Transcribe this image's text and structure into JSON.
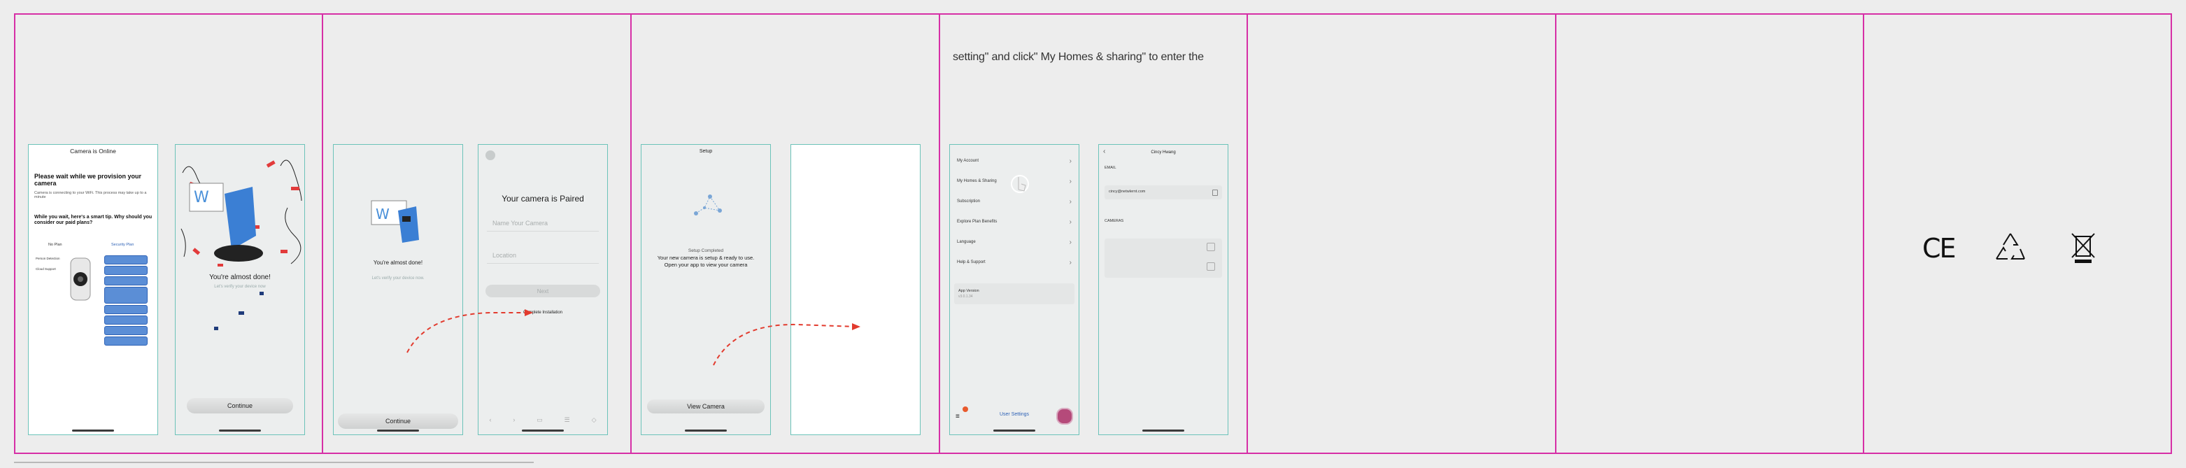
{
  "heading": "setting\" and click\" My Homes & sharing\" to enter the",
  "screen1": {
    "title": "Camera is Online",
    "wait_text": "Please wait while we provision your camera",
    "connecting_text": "Camera is connecting to your WiFi. This process may take up to a minute",
    "tip_text": "While you wait, here's a smart tip. Why should you consider our paid plans?",
    "no_plan": "No Plan",
    "security_plan": "Security Plan",
    "person_detection": "Person Detection",
    "cloud_support": "Cloud Support"
  },
  "screen2": {
    "title": "You're almost done!",
    "subtitle": "Let's verify your device now",
    "button": "Continue"
  },
  "screen3": {
    "title": "You're almost done!",
    "subtitle": "Let's verify your device now.",
    "button": "Continue"
  },
  "screen4": {
    "title": "Your camera is Paired",
    "name_placeholder": "Name Your Camera",
    "location_placeholder": "Location",
    "next": "Next",
    "link": "Complete Installation"
  },
  "screen5": {
    "title": "Setup",
    "status": "Setup Completed",
    "desc1": "Your new camera is setup & ready to use.",
    "desc2": "Open your app to view your camera",
    "button": "View Camera"
  },
  "screen7": {
    "menu": [
      "My Account",
      "My Homes & Sharing",
      "Subscription",
      "Explore Plan Benefits",
      "Language",
      "Help & Support"
    ],
    "app_version_label": "App Version",
    "app_version": "v3.0.1.34",
    "bottom_label": "User Settings"
  },
  "screen8": {
    "title": "Cincy Hwang",
    "email_label": "EMAIL",
    "email": "cincy@netwlernt.com",
    "cameras_label": "CAMERAS"
  },
  "symbols": {
    "ce": "CE"
  }
}
